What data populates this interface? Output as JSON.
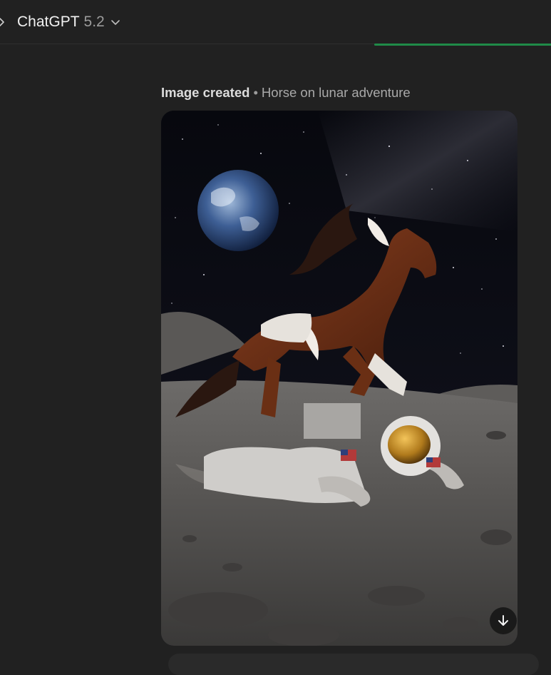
{
  "header": {
    "model_name": "ChatGPT",
    "model_version": "5.2"
  },
  "message": {
    "status": "Image created",
    "separator": "•",
    "title": "Horse on lunar adventure"
  },
  "icons": {
    "sidebar_toggle": "chevron-right-icon",
    "model_dropdown": "chevron-down-icon",
    "download": "arrow-down-icon"
  },
  "colors": {
    "background": "#212121",
    "accent_progress": "#1f8b48"
  }
}
